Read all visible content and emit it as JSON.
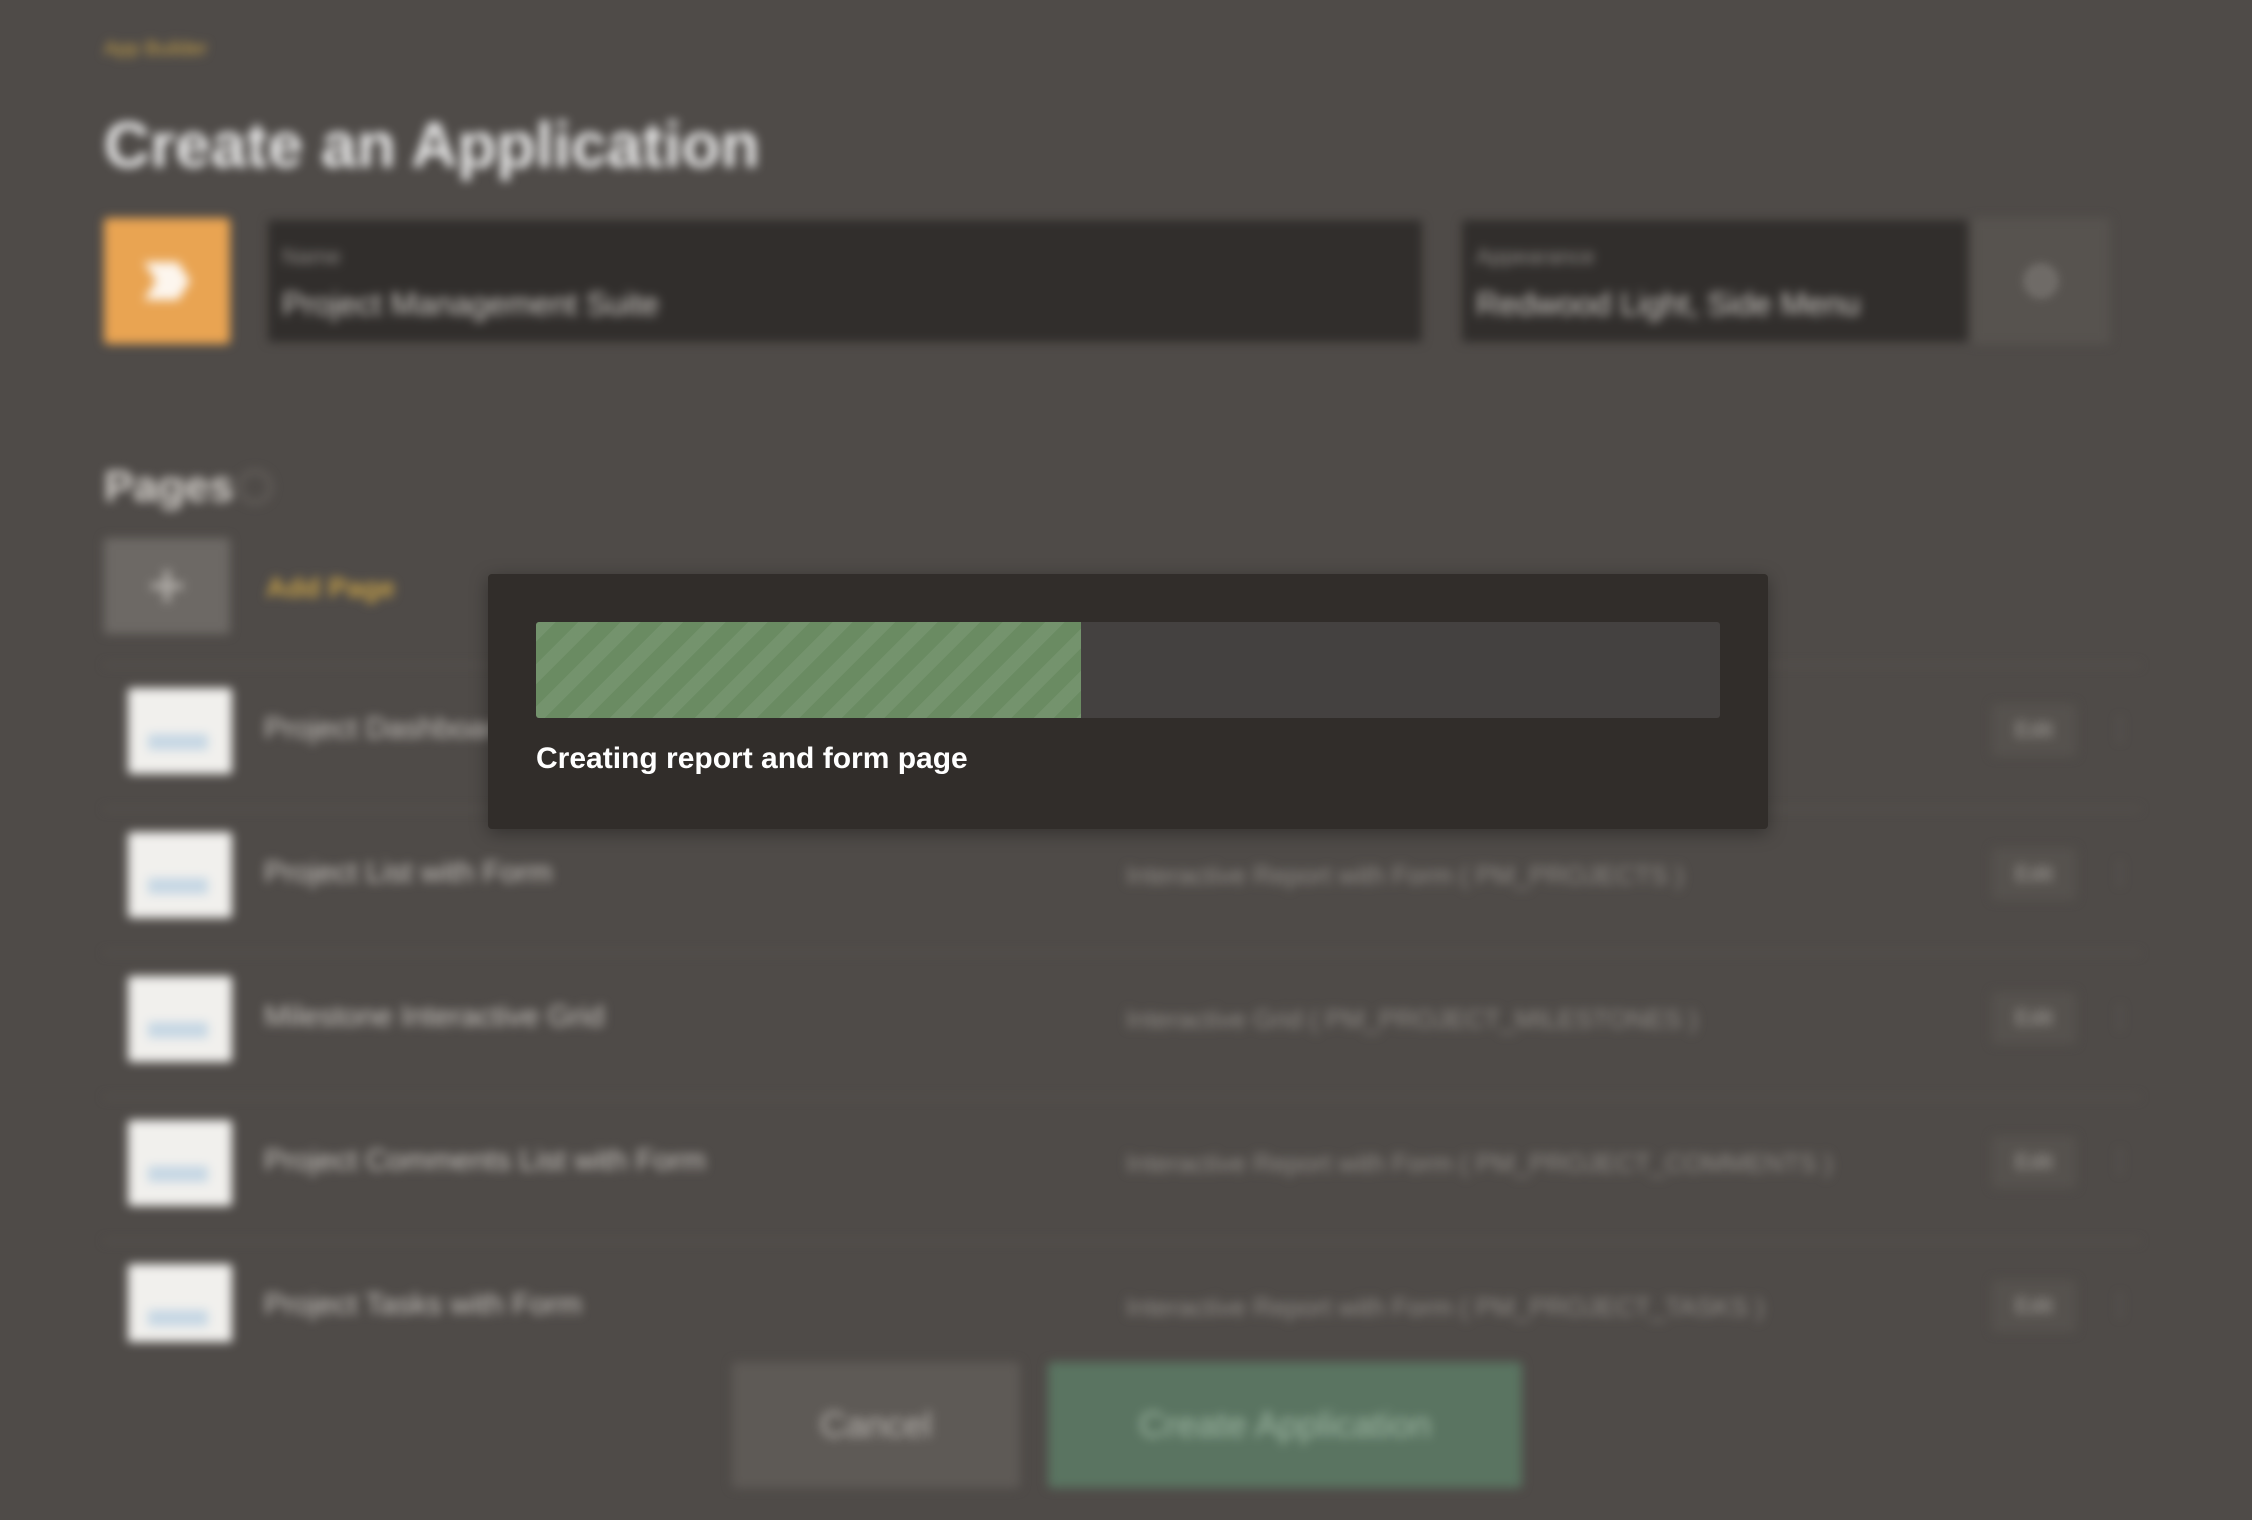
{
  "breadcrumb": "App Builder",
  "page_title": "Create an Application",
  "name_field": {
    "label": "Name",
    "value": "Project Management Suite"
  },
  "appearance_field": {
    "label": "Appearance",
    "value": "Redwood Light, Side Menu"
  },
  "pages_section": {
    "heading": "Pages",
    "add_page_label": "Add Page",
    "rows": [
      {
        "label": "Project Dashboard",
        "type": "",
        "edit": "Edit"
      },
      {
        "label": "Project List with Form",
        "type": "Interactive Report with Form ( PM_PROJECTS )",
        "edit": "Edit"
      },
      {
        "label": "Milestone Interactive Grid",
        "type": "Interactive Grid ( PM_PROJECT_MILESTONES )",
        "edit": "Edit"
      },
      {
        "label": "Project Comments List with Form",
        "type": "Interactive Report with Form ( PM_PROJECT_COMMENTS )",
        "edit": "Edit"
      },
      {
        "label": "Project Tasks with Form",
        "type": "Interactive Report with Form ( PM_PROJECT_TASKS )",
        "edit": "Edit"
      }
    ]
  },
  "footer": {
    "cancel_label": "Cancel",
    "create_label": "Create Application"
  },
  "progress": {
    "fraction": 0.46,
    "status_text": "Creating report and form page",
    "bar_color": "#6a8b62"
  },
  "colors": {
    "accent": "#e9a452",
    "link": "#c8a24a",
    "success": "#5a7461"
  },
  "icons": {
    "app_icon": "app-icon",
    "settings": "gear-icon",
    "add": "plus-icon",
    "help": "help-icon"
  }
}
